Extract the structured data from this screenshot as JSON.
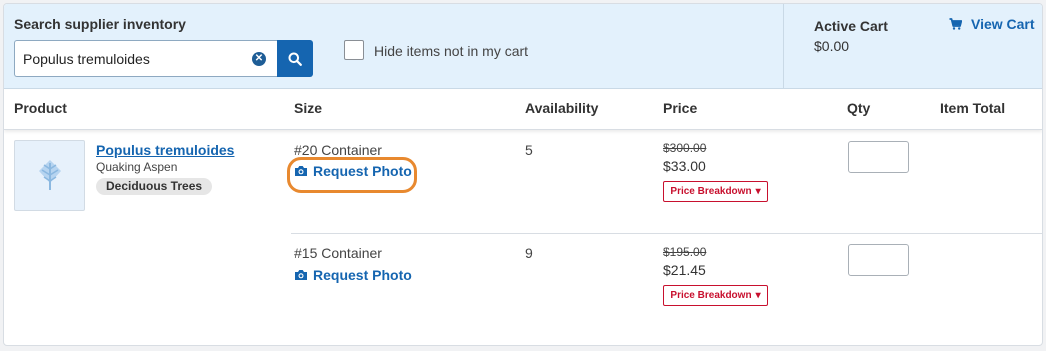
{
  "search": {
    "label": "Search supplier inventory",
    "value": "Populus tremuloides",
    "placeholder": "",
    "clear_icon": "circle-x-icon",
    "button_icon": "search-icon"
  },
  "filter": {
    "hide_label": "Hide items not in my cart",
    "checked": false
  },
  "cart": {
    "title": "Active Cart",
    "total": "$0.00",
    "view_label": "View Cart",
    "view_icon": "cart-icon"
  },
  "table": {
    "headers": {
      "product": "Product",
      "size": "Size",
      "availability": "Availability",
      "price": "Price",
      "qty": "Qty",
      "item_total": "Item Total"
    }
  },
  "product": {
    "image_icon": "plant-icon",
    "scientific_name": "Populus tremuloides",
    "common_name": "Quaking Aspen",
    "category": "Deciduous Trees",
    "variants": [
      {
        "size": "#20 Container",
        "request_photo": "Request Photo",
        "availability": "5",
        "original_price": "$300.00",
        "price": "$33.00",
        "breakdown_label": "Price Breakdown",
        "qty": "",
        "item_total": ""
      },
      {
        "size": "#15 Container",
        "request_photo": "Request Photo",
        "availability": "9",
        "original_price": "$195.00",
        "price": "$21.45",
        "breakdown_label": "Price Breakdown",
        "qty": "",
        "item_total": ""
      }
    ]
  },
  "colors": {
    "accent": "#1565b0",
    "topbar": "#e3f1fc",
    "highlight": "#e8892f",
    "breakdown": "#c8102e"
  }
}
